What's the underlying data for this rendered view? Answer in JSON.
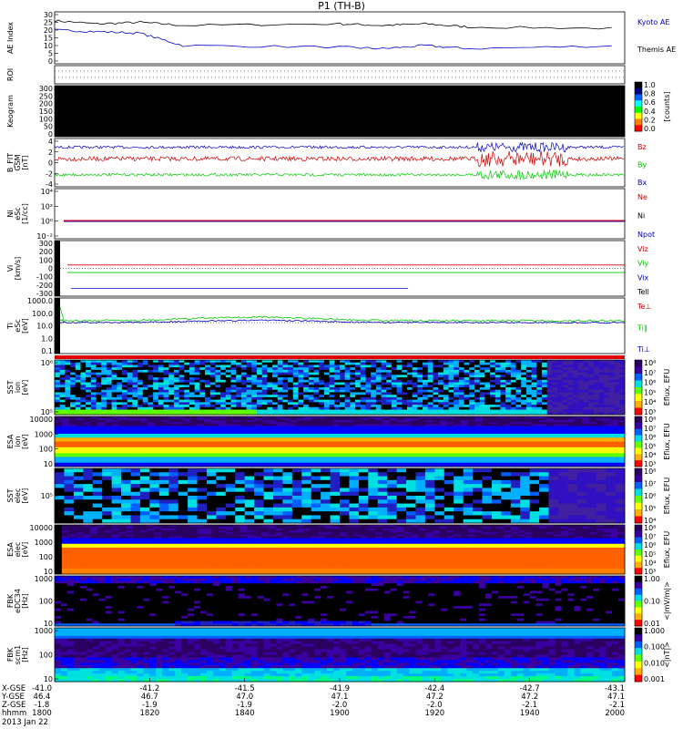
{
  "chart_data": {
    "title": "P1 (TH-B)",
    "panels": [
      {
        "id": "ae",
        "type": "line",
        "ylabel": "AE Index",
        "yticks": [
          "30",
          "25",
          "20",
          "15",
          "10",
          "5",
          "0"
        ],
        "ylim": [
          0,
          30
        ],
        "legend": [
          {
            "name": "Kyoto AE",
            "color": "#0000c8"
          },
          {
            "name": "Themis AE",
            "color": "#000000"
          }
        ],
        "series": [
          {
            "name": "Kyoto AE",
            "color": "#000000",
            "x": [
              1800,
              1815,
              1830,
              1845,
              1900,
              1915,
              1930,
              1945,
              2000
            ],
            "y": [
              26,
              24,
              25,
              23,
              24,
              23,
              24,
              22,
              21
            ]
          },
          {
            "name": "Themis AE",
            "color": "#0000c8",
            "x": [
              1800,
              1815,
              1830,
              1845,
              1900,
              1915,
              1930,
              1945,
              2000
            ],
            "y": [
              20,
              19,
              18,
              10,
              9,
              8,
              10,
              8,
              10
            ]
          }
        ]
      },
      {
        "id": "roi",
        "type": "line",
        "ylabel": "ROI",
        "yticks": [],
        "series": []
      },
      {
        "id": "keogram",
        "type": "heatmap",
        "ylabel": "Keogram",
        "yticks": [
          "300",
          "250",
          "200",
          "150",
          "100",
          "50",
          "0"
        ],
        "ylim": [
          0,
          300
        ],
        "colorbar": {
          "ticks": [
            "1.0",
            "0.8",
            "0.6",
            "0.4",
            "0.2",
            "0.0"
          ],
          "label": "[counts]"
        }
      },
      {
        "id": "bfit",
        "type": "line",
        "ylabel": "B_FIT",
        "ylabel2": "GSM",
        "unit": "[nT]",
        "yticks": [
          "4",
          "2",
          "0",
          "-2",
          "-4"
        ],
        "ylim": [
          -4,
          4
        ],
        "legend": [
          {
            "name": "Bz",
            "color": "#d00000"
          },
          {
            "name": "By",
            "color": "#00c800"
          },
          {
            "name": "Bx",
            "color": "#0000c8"
          }
        ],
        "series": [
          {
            "name": "Bz",
            "color": "#0000c8",
            "level": 3.3,
            "noise": 0.3
          },
          {
            "name": "By",
            "color": "#d00000",
            "level": 0.5,
            "noise": 0.5
          },
          {
            "name": "Bx",
            "color": "#00c800",
            "level": -1.8,
            "noise": 0.4
          }
        ]
      },
      {
        "id": "ni",
        "type": "line",
        "ylabel": "Ni",
        "ylabel2": "eSc",
        "unit": "[1/cc]",
        "yticks": [
          "10⁴",
          "10²",
          "10⁰",
          "10⁻²"
        ],
        "legend": [
          {
            "name": "Ne",
            "color": "#d00000"
          },
          {
            "name": "Ni",
            "color": "#000000"
          },
          {
            "name": "Npot",
            "color": "#0000c8"
          }
        ],
        "series": [
          {
            "name": "Ne",
            "color": "#d00000",
            "level": 0.5
          },
          {
            "name": "Npot",
            "color": "#0000c8",
            "level": 0.48
          }
        ]
      },
      {
        "id": "vi",
        "type": "line",
        "ylabel": "Vi",
        "ylabel2": "",
        "unit": "[km/s]",
        "yticks": [
          "300",
          "200",
          "100",
          "0",
          "-100",
          "-200",
          "-300"
        ],
        "ylim": [
          -300,
          300
        ],
        "legend": [
          {
            "name": "Viz",
            "color": "#d00000"
          },
          {
            "name": "Viy",
            "color": "#00c800"
          },
          {
            "name": "Vix",
            "color": "#0000c8"
          },
          {
            "name": "Tell",
            "color": "#000000"
          }
        ],
        "series": [
          {
            "name": "Viz",
            "color": "#d00000",
            "level": 40
          },
          {
            "name": "Viy",
            "color": "#00c800",
            "level": -50
          },
          {
            "name": "Vix",
            "color": "#0000c8",
            "level": -240
          }
        ]
      },
      {
        "id": "ti",
        "type": "line",
        "ylabel": "Ti",
        "ylabel2": "eSc",
        "unit": "[eV]",
        "yticks": [
          "1000.0",
          "100.0",
          "10.0",
          "1.0",
          "0.1"
        ],
        "legend": [
          {
            "name": "Te⊥",
            "color": "#d00000"
          },
          {
            "name": "Ti∥",
            "color": "#00c800"
          },
          {
            "name": "Ti⊥",
            "color": "#0000c8"
          }
        ],
        "series": [
          {
            "name": "Ti∥",
            "color": "#00c800",
            "level": 60
          },
          {
            "name": "Ti⊥",
            "color": "#0000c8",
            "level": 40
          }
        ]
      },
      {
        "id": "sst_e",
        "type": "heatmap",
        "ylabel": "SST",
        "ylabel2": "ion",
        "unit": "[eV]",
        "yticks": [
          "10⁶",
          "10⁵"
        ],
        "colorbar": {
          "ticks": [
            "10⁸",
            "10⁷",
            "10⁶",
            "10⁵",
            "10⁴",
            "10³"
          ],
          "label": "Eflux, EFU"
        }
      },
      {
        "id": "esa_e",
        "type": "heatmap",
        "ylabel": "ESA",
        "ylabel2": "ion",
        "unit": "[eV]",
        "yticks": [
          "10000",
          "1000",
          "100",
          "10"
        ],
        "colorbar": {
          "ticks": [
            "10⁸",
            "10⁷",
            "10⁶",
            "10⁵",
            "10⁴",
            "10³"
          ],
          "label": "Eflux, EFU"
        }
      },
      {
        "id": "sst_i",
        "type": "heatmap",
        "ylabel": "SST",
        "ylabel2": "elec",
        "unit": "[eV]",
        "yticks": [
          "10⁵"
        ],
        "colorbar": {
          "ticks": [
            "10⁸",
            "10⁷",
            "10⁶",
            "10⁵",
            "10⁴"
          ],
          "label": "Eflux, EFU"
        }
      },
      {
        "id": "esa_i",
        "type": "heatmap",
        "ylabel": "ESA",
        "ylabel2": "elec",
        "unit": "[eV]",
        "yticks": [
          "10000",
          "1000",
          "100",
          "10"
        ],
        "colorbar": {
          "ticks": [
            "10⁸",
            "10⁷",
            "10⁶",
            "10⁵",
            "10⁴",
            "10³"
          ],
          "label": "Eflux, EFU"
        }
      },
      {
        "id": "fbk_e",
        "type": "heatmap",
        "ylabel": "FBK",
        "ylabel2": "eDC34",
        "unit": "[Hz]",
        "yticks": [
          "1000",
          "100",
          "10"
        ],
        "colorbar": {
          "ticks": [
            "1.00",
            "0.10",
            "0.01"
          ],
          "label": "<|mV/m|>"
        }
      },
      {
        "id": "fbk_b",
        "type": "heatmap",
        "ylabel": "FBK",
        "ylabel2": "scm1",
        "unit": "[Hz]",
        "yticks": [
          "1000",
          "100",
          "10"
        ],
        "colorbar": {
          "ticks": [
            "1.000",
            "0.100",
            "0.010",
            "0.001"
          ],
          "label": "<|nT|>"
        }
      }
    ],
    "x_axis": {
      "ticks": [
        {
          "hhmm": "1800",
          "x_gse": "-41.0",
          "y_gse": "46.4",
          "z_gse": "-1.8"
        },
        {
          "hhmm": "1820",
          "x_gse": "-41.2",
          "y_gse": "46.7",
          "z_gse": "-1.9"
        },
        {
          "hhmm": "1840",
          "x_gse": "-41.5",
          "y_gse": "47.0",
          "z_gse": "-1.9"
        },
        {
          "hhmm": "1900",
          "x_gse": "-41.9",
          "y_gse": "47.1",
          "z_gse": "-2.0"
        },
        {
          "hhmm": "1920",
          "x_gse": "-42.4",
          "y_gse": "47.2",
          "z_gse": "-2.0"
        },
        {
          "hhmm": "1940",
          "x_gse": "-42.7",
          "y_gse": "47.2",
          "z_gse": "-2.1"
        },
        {
          "hhmm": "2000",
          "x_gse": "-43.1",
          "y_gse": "47.1",
          "z_gse": "-2.1"
        }
      ],
      "row_labels": [
        "X-GSE",
        "Y-GSE",
        "Z-GSE",
        "hhmm"
      ],
      "date": "2013 Jan 22"
    }
  }
}
